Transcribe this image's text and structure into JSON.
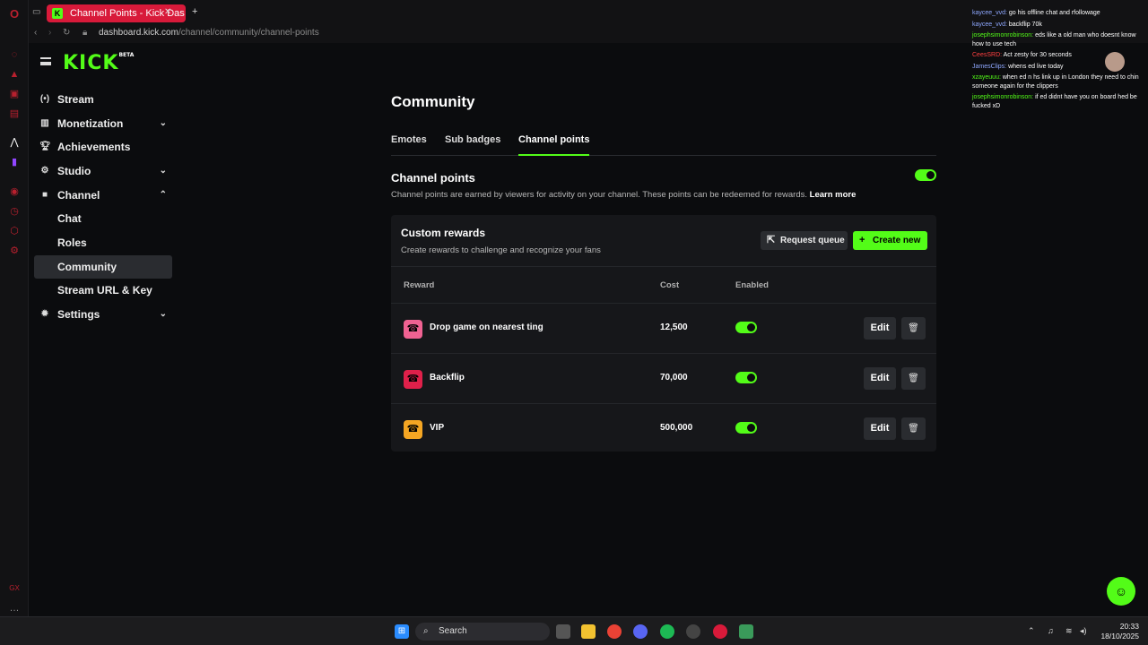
{
  "browser": {
    "tab_title": "Channel Points - Kick Das",
    "url_host": "dashboard.kick.com",
    "url_path": "/channel/community/channel-points"
  },
  "sidebar": {
    "logo": "KICK",
    "logo_badge": "BETA",
    "items": [
      {
        "label": "Stream",
        "icon": "broadcast-icon",
        "expandable": false
      },
      {
        "label": "Monetization",
        "icon": "chart-icon",
        "expandable": true,
        "expanded": false
      },
      {
        "label": "Achievements",
        "icon": "trophy-icon",
        "expandable": false
      },
      {
        "label": "Studio",
        "icon": "gear-icon",
        "expandable": true,
        "expanded": false
      },
      {
        "label": "Channel",
        "icon": "camera-icon",
        "expandable": true,
        "expanded": true
      },
      {
        "label": "Chat",
        "sub": true
      },
      {
        "label": "Roles",
        "sub": true
      },
      {
        "label": "Community",
        "sub": true,
        "active": true
      },
      {
        "label": "Stream URL & Key",
        "sub": true
      },
      {
        "label": "Settings",
        "icon": "cog-icon",
        "expandable": true,
        "expanded": false
      }
    ]
  },
  "main": {
    "title": "Community",
    "tabs": [
      "Emotes",
      "Sub badges",
      "Channel points"
    ],
    "active_tab": "Channel points",
    "channel_points": {
      "title": "Channel points",
      "description": "Channel points are earned by viewers for activity on your channel. These points can be redeemed for rewards.",
      "learn_more": "Learn more",
      "enabled": true
    },
    "custom_rewards": {
      "title": "Custom rewards",
      "subtitle": "Create rewards to challenge and recognize your fans",
      "request_queue_label": "Request queue",
      "create_new_label": "Create new",
      "columns": [
        "Reward",
        "Cost",
        "Enabled"
      ],
      "rows": [
        {
          "name": "Drop game on nearest ting",
          "cost": "12,500",
          "enabled": true,
          "color": "#f06292"
        },
        {
          "name": "Backflip",
          "cost": "70,000",
          "enabled": true,
          "color": "#e0204a"
        },
        {
          "name": "VIP",
          "cost": "500,000",
          "enabled": true,
          "color": "#f5a623"
        }
      ],
      "edit_label": "Edit"
    }
  },
  "chat_overlay": [
    {
      "user": "kaycee_vvd:",
      "text": "go his offline chat and rfollowage"
    },
    {
      "user": "kaycee_vvd:",
      "text": "backflip 70k"
    },
    {
      "user": "josephsimonrobinson:",
      "text": "eds like a old man who doesnt know how to use tech"
    },
    {
      "user": "CeesSRD:",
      "text": "Act zesty for 30 seconds"
    },
    {
      "user": "JamesClips:",
      "text": "whens ed live today"
    },
    {
      "user": "xzayeuuu:",
      "text": "when ed n hs link up in London they need to chin someone again for the clippers"
    },
    {
      "user": "josephsimonrobinson:",
      "text": "if ed didnt have you on board hed be fucked xD"
    }
  ],
  "taskbar": {
    "search_label": "Search",
    "time": "20:33",
    "date": "18/10/2025"
  },
  "colors": {
    "accent": "#53fc18",
    "opera_red": "#d81a3a",
    "background": "#0b0c0e",
    "card": "#16171a"
  }
}
